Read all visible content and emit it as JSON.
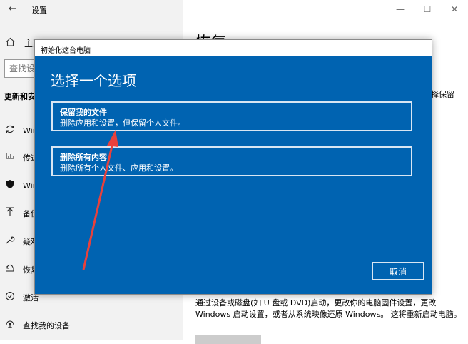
{
  "settings": {
    "app_title": "设置",
    "home_label": "主页",
    "search_placeholder": "查找设置",
    "section_heading": "更新和安全",
    "nav_items": [
      {
        "icon": "sync-icon",
        "label": "Windows 更新"
      },
      {
        "icon": "delivery-icon",
        "label": "传递优化"
      },
      {
        "icon": "shield-icon",
        "label": "Windows 安全中心"
      },
      {
        "icon": "backup-icon",
        "label": "备份"
      },
      {
        "icon": "wrench-icon",
        "label": "疑难解答"
      },
      {
        "icon": "recovery-icon",
        "label": "恢复"
      },
      {
        "icon": "activation-icon",
        "label": "激活"
      },
      {
        "icon": "find-device-icon",
        "label": "查找我的设备"
      }
    ],
    "content": {
      "title": "恢复",
      "side_text": "择保留",
      "description": "通过设备或磁盘(如 U 盘或 DVD)启动，更改你的电脑固件设置，更改 Windows 启动设置，或者从系统映像还原 Windows。 这将重新启动电脑。"
    }
  },
  "dialog": {
    "title": "初始化这台电脑",
    "heading": "选择一个选项",
    "options": [
      {
        "title": "保留我的文件",
        "description": "删除应用和设置，但保留个人文件。"
      },
      {
        "title": "删除所有内容",
        "description": "删除所有个人文件、应用和设置。"
      }
    ],
    "cancel_label": "取消",
    "accent_color": "#0063b1"
  },
  "annotation": {
    "color": "#e8413c",
    "type": "arrow"
  }
}
